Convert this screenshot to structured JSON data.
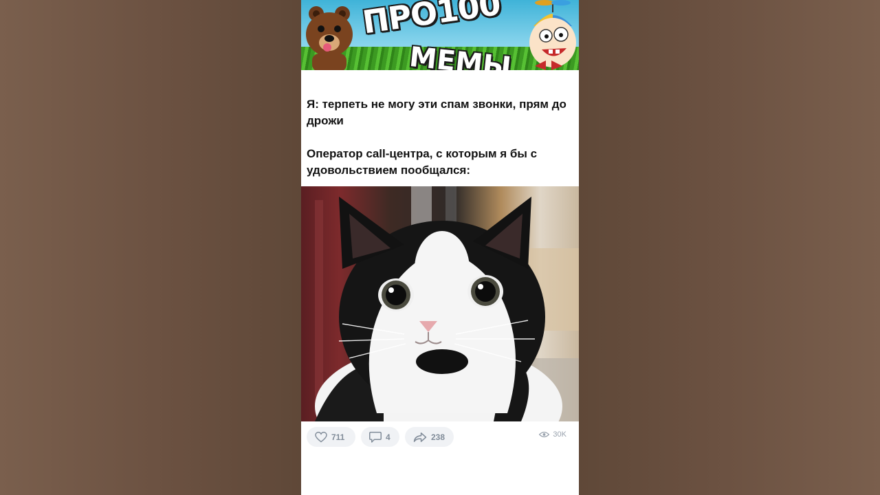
{
  "banner": {
    "title": "ПРО100",
    "subtitle": "МЕМЫ"
  },
  "post": {
    "line1": "Я: терпеть не могу эти спам звонки, прям до дрожи",
    "line2": "Оператор call-центра, с которым я  бы  с  удовольствием  пообщался:",
    "image_icon": "black-and-white-cat-photo"
  },
  "actions": {
    "likes": "711",
    "comments": "4",
    "shares": "238",
    "views": "30K",
    "icons": [
      "heart-icon",
      "comment-icon",
      "share-icon",
      "eye-icon"
    ]
  },
  "colors": {
    "banner_sky": "#3fb3d8",
    "grass": "#3c9a22",
    "pill_bg": "#f0f2f5",
    "pill_text": "#818c99",
    "backdrop": "#6b5141"
  }
}
